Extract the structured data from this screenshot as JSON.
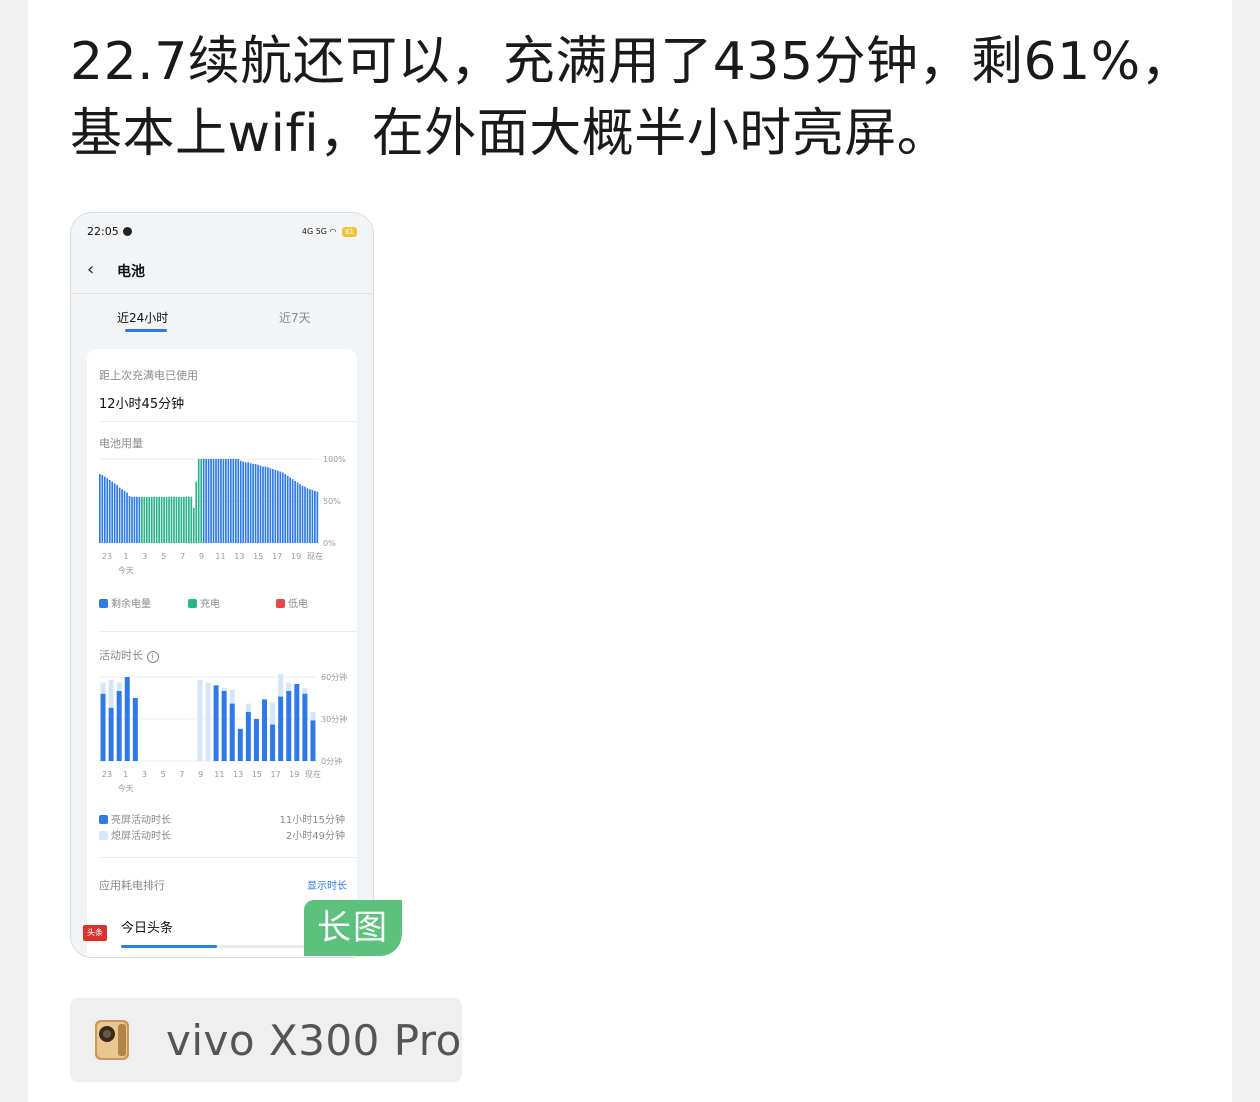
{
  "post": {
    "text_line1": "22.7续航还可以，充满用了435分钟，剩61%，",
    "text_line2": "基本上wifi，在外面大概半小时亮屏。"
  },
  "screenshot": {
    "status_bar": {
      "time": "22:05",
      "signal_text": "4G 5G",
      "battery": "61"
    },
    "app_bar": {
      "back_icon": "chevron-left-icon",
      "title": "电池"
    },
    "tabs": [
      {
        "label": "近24小时",
        "active": true
      },
      {
        "label": "近7天",
        "active": false
      }
    ],
    "since_full": {
      "label": "距上次充满电已使用",
      "value": "12小时45分钟"
    },
    "battery_usage": {
      "label": "电池用量",
      "legend": [
        {
          "label": "剩余电量",
          "color": "#2f7be6"
        },
        {
          "label": "充电",
          "color": "#2bb48a"
        },
        {
          "label": "低电",
          "color": "#e5484d"
        }
      ]
    },
    "activity": {
      "label": "活动时长",
      "info_icon": "info-icon",
      "legend": [
        {
          "label": "亮屏活动时长",
          "value": "11小时15分钟",
          "color": "#2f7be6"
        },
        {
          "label": "熄屏活动时长",
          "value": "2小时49分钟",
          "color": "#d6e6fa"
        }
      ]
    },
    "ranking": {
      "label": "应用耗电排行",
      "action": "显示时长",
      "top_app": {
        "icon_text": "头条",
        "name": "今日头条"
      }
    }
  },
  "long_image_badge": "长图",
  "device": {
    "name": "vivo X300 Pro",
    "icon": "phone-icon"
  },
  "chart_data": [
    {
      "type": "bar",
      "title": "电池用量",
      "x_ticks": [
        "23",
        "1",
        "3",
        "5",
        "7",
        "9",
        "11",
        "13",
        "15",
        "17",
        "19",
        "现在"
      ],
      "x_sub_label": "今天",
      "y_ticks": [
        "100%",
        "50%",
        "0%"
      ],
      "ylim": [
        0,
        100
      ],
      "series": [
        {
          "name": "剩余电量",
          "color": "#2f7be6",
          "values": [
            82,
            81,
            79,
            77,
            75,
            73,
            71,
            69,
            66,
            64,
            62,
            60,
            56,
            55,
            55,
            55,
            55,
            55,
            55,
            55,
            55,
            55,
            55,
            55,
            55,
            55,
            55,
            55,
            55,
            55,
            55,
            55,
            55,
            55,
            55,
            55,
            55,
            55,
            42,
            73,
            100,
            100,
            100,
            100,
            100,
            100,
            100,
            100,
            100,
            100,
            100,
            100,
            100,
            100,
            100,
            100,
            100,
            98,
            97,
            96,
            96,
            95,
            94,
            94,
            93,
            92,
            91,
            91,
            90,
            89,
            88,
            87,
            86,
            85,
            84,
            82,
            80,
            78,
            76,
            74,
            72,
            70,
            68,
            67,
            65,
            64,
            63,
            62,
            61
          ]
        },
        {
          "name": "充电",
          "color": "#2bb48a",
          "range": [
            17,
            42
          ]
        }
      ]
    },
    {
      "type": "bar",
      "title": "活动时长",
      "x_ticks": [
        "23",
        "1",
        "3",
        "5",
        "7",
        "9",
        "11",
        "13",
        "15",
        "17",
        "19",
        "现在"
      ],
      "x_sub_label": "今天",
      "y_ticks": [
        "60分钟",
        "30分钟",
        "0分钟"
      ],
      "ylim": [
        0,
        60
      ],
      "series": [
        {
          "name": "亮屏活动时长",
          "color": "#2f7be6",
          "values": [
            48,
            38,
            50,
            60,
            45,
            0,
            0,
            0,
            0,
            0,
            0,
            0,
            0,
            0,
            54,
            50,
            41,
            23,
            35,
            30,
            44,
            26,
            46,
            50,
            55,
            48,
            29
          ]
        },
        {
          "name": "熄屏活动时长",
          "color": "#d6e6fa",
          "values": [
            8,
            20,
            6,
            0,
            0,
            0,
            0,
            0,
            0,
            0,
            0,
            0,
            58,
            56,
            0,
            2,
            10,
            0,
            6,
            0,
            0,
            16,
            16,
            6,
            0,
            4,
            6
          ]
        }
      ]
    }
  ]
}
